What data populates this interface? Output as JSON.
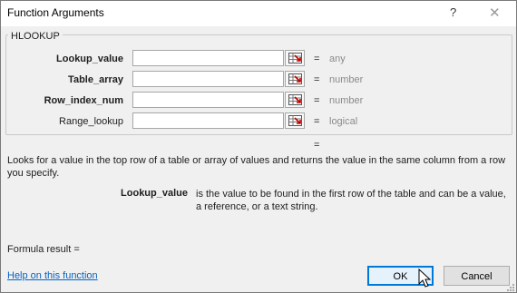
{
  "window": {
    "title": "Function Arguments",
    "help_glyph": "?",
    "close_glyph": "✕"
  },
  "function_name": "HLOOKUP",
  "arguments": [
    {
      "label": "Lookup_value",
      "bold": true,
      "value": "",
      "result": "any"
    },
    {
      "label": "Table_array",
      "bold": true,
      "value": "",
      "result": "number"
    },
    {
      "label": "Row_index_num",
      "bold": true,
      "value": "",
      "result": "number"
    },
    {
      "label": "Range_lookup",
      "bold": false,
      "value": "",
      "result": "logical"
    }
  ],
  "equals_sign": "=",
  "description": "Looks for a value in the top row of a table or array of values and returns the value in the same column from a row you specify.",
  "arg_help": {
    "name": "Lookup_value",
    "text": "is the value to be found in the first row of the table and can be a value, a reference, or a text string."
  },
  "formula_result_label": "Formula result =",
  "help_link": "Help on this function",
  "buttons": {
    "ok": "OK",
    "cancel": "Cancel"
  },
  "colors": {
    "link": "#0563c1",
    "focus": "#0078d7",
    "muted": "#8a8a8a"
  }
}
